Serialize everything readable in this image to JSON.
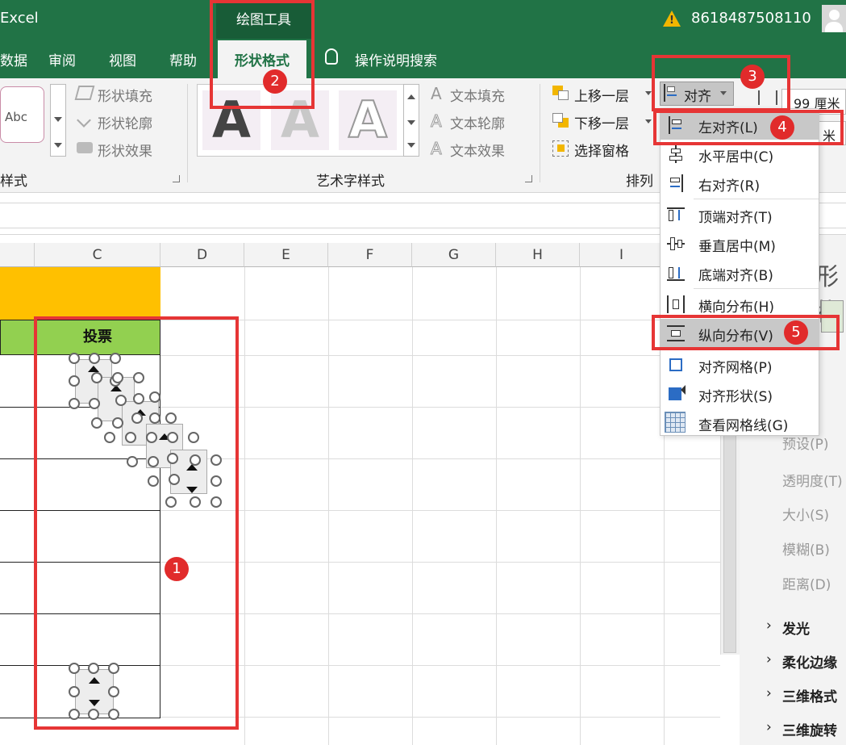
{
  "titlebar": {
    "app": "Excel",
    "drawing_tools": "绘图工具",
    "user_id": "8618487508110",
    "tabs": [
      "数据",
      "审阅",
      "视图",
      "帮助"
    ],
    "format_tab": "形状格式",
    "search": "操作说明搜索"
  },
  "ribbon": {
    "shape_styles": {
      "abc": "Abc",
      "fill": "形状填充",
      "outline": "形状轮廓",
      "effect": "形状效果",
      "group": "样式"
    },
    "wordart": {
      "fill": "文本填充",
      "outline": "文本轮廓",
      "effect": "文本效果",
      "group": "艺术字样式",
      "glyph": "A"
    },
    "arrange": {
      "bring_forward": "上移一层",
      "send_backward": "下移一层",
      "selection_pane": "选择窗格",
      "group": "排列",
      "align": "对齐"
    },
    "size": {
      "width_value": "99 厘米",
      "height_suffix": "米"
    }
  },
  "align_menu": [
    {
      "label": "左对齐(L)",
      "icon": "align-left-icon",
      "highlighted": true
    },
    {
      "label": "水平居中(C)",
      "icon": "align-center-icon"
    },
    {
      "label": "右对齐(R)",
      "icon": "align-right-icon"
    },
    {
      "label": "顶端对齐(T)",
      "icon": "align-top-icon"
    },
    {
      "label": "垂直居中(M)",
      "icon": "align-middle-icon"
    },
    {
      "label": "底端对齐(B)",
      "icon": "align-bottom-icon"
    },
    {
      "label": "横向分布(H)",
      "icon": "distribute-horizontal-icon"
    },
    {
      "label": "纵向分布(V)",
      "icon": "distribute-vertical-icon",
      "highlighted": true
    },
    {
      "label": "对齐网格(P)",
      "icon": "snap-grid-icon"
    },
    {
      "label": "对齐形状(S)",
      "icon": "snap-shape-icon"
    },
    {
      "label": "查看网格线(G)",
      "icon": "view-gridlines-icon"
    }
  ],
  "sheet": {
    "columns": [
      "C",
      "D",
      "E",
      "F",
      "G",
      "H",
      "I"
    ],
    "header_cell": "投票"
  },
  "side_panel": {
    "partial_title": "形状",
    "gray_items": [
      "预设(P)",
      "透明度(T)",
      "大小(S)",
      "模糊(B)",
      "距离(D)"
    ],
    "sections": [
      "发光",
      "柔化边缘",
      "三维格式",
      "三维旋转"
    ]
  },
  "annotations": [
    "1",
    "2",
    "3",
    "4",
    "5"
  ],
  "colors": {
    "excel_green": "#217346",
    "annotation_red": "#e63535",
    "header_orange": "#FFC000",
    "header_green": "#92D050"
  }
}
